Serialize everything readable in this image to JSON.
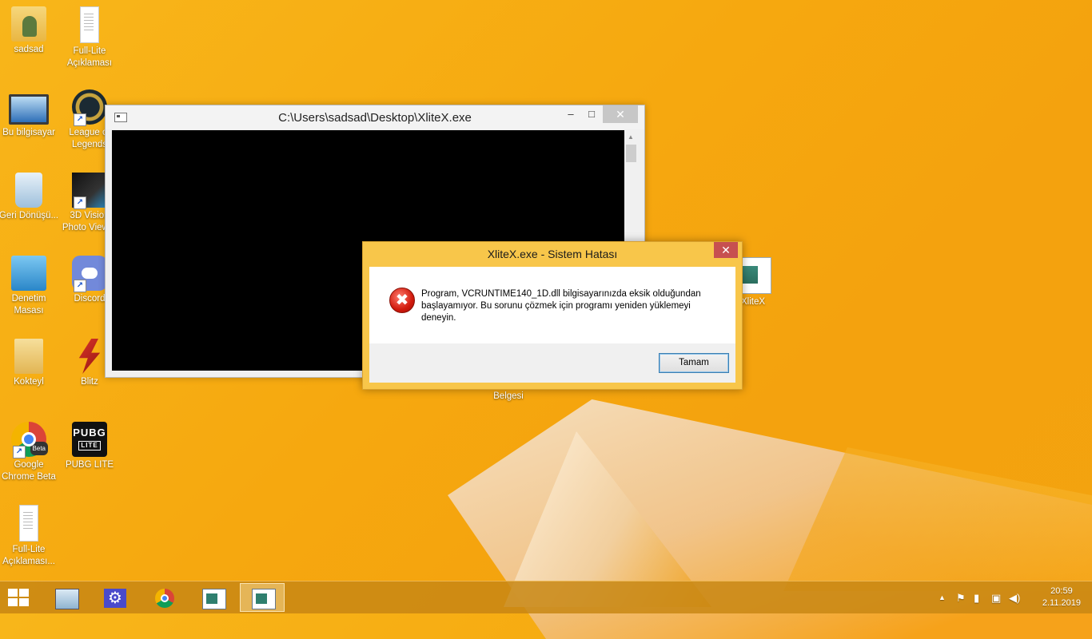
{
  "desktop": {
    "icons": [
      {
        "label": "sadsad",
        "icon": "user-folder-icon"
      },
      {
        "label": "Full-Lite Açıklaması",
        "icon": "text-document-icon"
      },
      {
        "label": "Bu bilgisayar",
        "icon": "computer-icon"
      },
      {
        "label": "League of Legends",
        "icon": "league-of-legends-icon"
      },
      {
        "label": "Geri Dönüşü...",
        "icon": "recycle-bin-icon"
      },
      {
        "label": "3D Vision Photo Viewer",
        "icon": "3d-vision-icon"
      },
      {
        "label": "Denetim Masası",
        "icon": "control-panel-icon"
      },
      {
        "label": "Discord",
        "icon": "discord-icon"
      },
      {
        "label": "Kokteyl",
        "icon": "folder-icon"
      },
      {
        "label": "Blitz",
        "icon": "blitz-icon"
      },
      {
        "label": "Google Chrome Beta",
        "icon": "chrome-beta-icon"
      },
      {
        "label": "PUBG LITE",
        "icon": "pubg-lite-icon"
      },
      {
        "label": "Full-Lite Açıklaması...",
        "icon": "text-document-icon"
      },
      {
        "label": "XliteX",
        "icon": "xlitex-icon"
      },
      {
        "label": "Belgesi",
        "icon": "document-icon"
      }
    ]
  },
  "console": {
    "title": "C:\\Users\\sadsad\\Desktop\\XliteX.exe",
    "minimize": "–",
    "maximize": "□",
    "close": "✕"
  },
  "dialog": {
    "title": "XliteX.exe - Sistem Hatası",
    "close": "✕",
    "message": "Program, VCRUNTIME140_1D.dll bilgisayarınızda eksik olduğundan başlayamıyor. Bu sorunu çözmek için programı yeniden yüklemeyi deneyin.",
    "ok_label": "Tamam",
    "error_icon_glyph": "✖"
  },
  "taskbar": {
    "items": [
      {
        "icon": "resource-monitor-icon",
        "active": false
      },
      {
        "icon": "settings-icon",
        "active": false
      },
      {
        "icon": "chrome-beta-icon",
        "active": false
      },
      {
        "icon": "xlitex-window-icon",
        "active": false
      },
      {
        "icon": "xlitex-window-icon",
        "active": true
      }
    ],
    "tray": {
      "arrow": "▲",
      "flag": "⚑",
      "power": "▮",
      "network": "▣",
      "volume": "◀)"
    },
    "time": "20:59",
    "date": "2.11.2019"
  },
  "colors": {
    "wallpaper": "#f6a80f",
    "dialog_frame": "#f8c64a",
    "close_red": "#c75050"
  }
}
